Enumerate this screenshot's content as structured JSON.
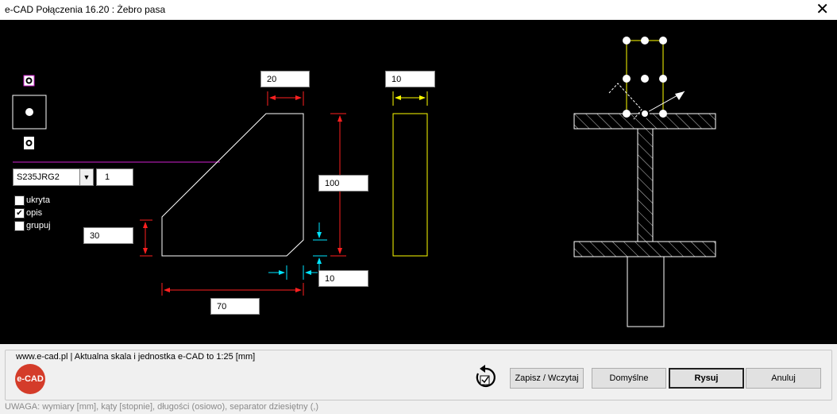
{
  "window": {
    "title": "e-CAD Połączenia 16.20 : Żebro pasa",
    "close_glyph": "✕"
  },
  "drawing": {
    "dim_top_width": "20",
    "dim_thickness": "10",
    "dim_height": "100",
    "dim_left": "30",
    "dim_chamfer": "10",
    "dim_bottom": "70"
  },
  "material": {
    "grade": "S235JRG2",
    "quantity": "1"
  },
  "options": [
    {
      "label": "ukryta",
      "checked": false
    },
    {
      "label": "opis",
      "checked": true
    },
    {
      "label": "grupuj",
      "checked": false
    }
  ],
  "info": {
    "text": "www.e-cad.pl | Aktualna skala i jednostka e-CAD to 1:25 [mm]"
  },
  "logo": {
    "text": "e-CAD",
    "color": "#d43c2a"
  },
  "buttons": {
    "save_load": "Zapisz / Wczytaj",
    "defaults": "Domyślne",
    "draw": "Rysuj",
    "cancel": "Anuluj"
  },
  "footer": {
    "note": "UWAGA: wymiary [mm], kąty [stopnie], długości (osiowo), separator dziesiętny (,)"
  },
  "colors": {
    "dimension": "#ff2020",
    "thickness_dim": "#ffff00",
    "chamfer_dim": "#00e5ff",
    "plate": "#ffff00",
    "magenta": "#d020d0"
  }
}
